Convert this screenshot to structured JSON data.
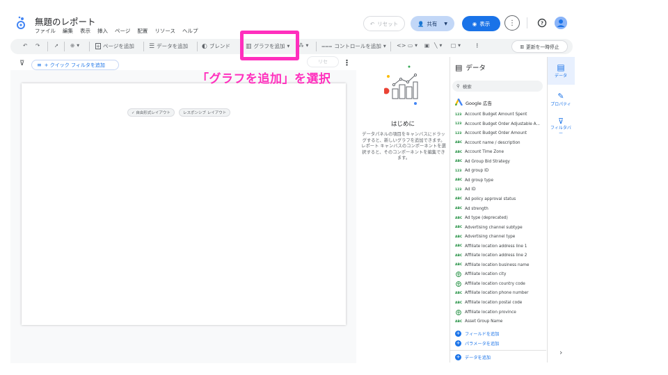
{
  "report": {
    "title": "無題のレポート",
    "menu": [
      "ファイル",
      "編集",
      "表示",
      "挿入",
      "ページ",
      "配置",
      "リソース",
      "ヘルプ"
    ]
  },
  "header": {
    "reset": "リセット",
    "share": "共有",
    "view": "表示"
  },
  "toolbar": {
    "add_page": "ページを追加",
    "add_data": "データを追加",
    "blend": "ブレンド",
    "add_chart": "グラフを追加",
    "add_control": "コントロールを追加",
    "pause_update": "更新を一時停止"
  },
  "filter": {
    "quick_filter": "+ クイック フィルタを追加",
    "reset_faint": "リセ"
  },
  "canvas": {
    "chip_free": "✓ 自由形式レイアウト",
    "chip_responsive": "レスポンシブ レイアウト"
  },
  "annotation": "「グラフを追加」を選択",
  "intro": {
    "heading": "はじめに",
    "body": "データパネルの項目をキャンバスにドラッグすると、新しいグラフを追加できます。レポート キャンバスのコンポーネントを選択すると、そのコンポーネントを編集できます。"
  },
  "data_panel": {
    "title": "データ",
    "search_placeholder": "検索",
    "source": "Google 広告",
    "fields": [
      {
        "type": "123",
        "name": "Account Budget Amount Spent"
      },
      {
        "type": "123",
        "name": "Account Budget Order Adjustable A..."
      },
      {
        "type": "123",
        "name": "Account Budget Order Amount"
      },
      {
        "type": "ABC",
        "name": "Account name / description"
      },
      {
        "type": "ABC",
        "name": "Account Time Zone"
      },
      {
        "type": "ABC",
        "name": "Ad Group Bid Strategy"
      },
      {
        "type": "123",
        "name": "Ad group ID"
      },
      {
        "type": "ABC",
        "name": "Ad group type"
      },
      {
        "type": "123",
        "name": "Ad ID"
      },
      {
        "type": "ABC",
        "name": "Ad policy approval status"
      },
      {
        "type": "ABC",
        "name": "Ad strength"
      },
      {
        "type": "ABC",
        "name": "Ad type (deprecated)"
      },
      {
        "type": "ABC",
        "name": "Advertising channel subtype"
      },
      {
        "type": "ABC",
        "name": "Advertising channel type"
      },
      {
        "type": "ABC",
        "name": "Affiliate location address line 1"
      },
      {
        "type": "ABC",
        "name": "Affiliate location address line 2"
      },
      {
        "type": "ABC",
        "name": "Affiliate location business name"
      },
      {
        "type": "GEO",
        "name": "Affiliate location city"
      },
      {
        "type": "GEO",
        "name": "Affiliate location country code"
      },
      {
        "type": "ABC",
        "name": "Affiliate location phone number"
      },
      {
        "type": "ABC",
        "name": "Affiliate location postal code"
      },
      {
        "type": "GEO",
        "name": "Affiliate location province"
      },
      {
        "type": "ABC",
        "name": "Asset Group Name"
      }
    ],
    "add_field": "フィールドを追加",
    "add_parameter": "パラメータを追加",
    "add_data": "データを追加"
  },
  "rail": {
    "data": "データ",
    "properties": "プロパティ",
    "filter": "フィルタバー"
  },
  "colors": {
    "highlight": "#ff2fbd",
    "accent": "#1a73e8"
  }
}
